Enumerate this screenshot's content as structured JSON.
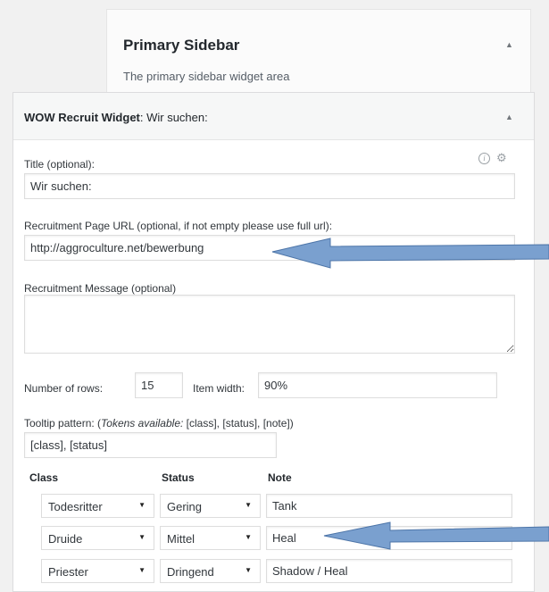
{
  "sidebar": {
    "title": "Primary Sidebar",
    "description": "The primary sidebar widget area",
    "toggle_glyph": "▲"
  },
  "widget": {
    "name": "WOW Recruit Widget",
    "title_suffix": ": Wir suchen:",
    "toggle_glyph": "▲",
    "icons": [
      "info-icon",
      "bug-icon"
    ],
    "title_label": "Title (optional):",
    "title_value": "Wir suchen:",
    "url_label": "Recruitment Page URL (optional, if not empty please use full url):",
    "url_value": "http://aggroculture.net/bewerbung",
    "message_label": "Recruitment Message (optional)",
    "message_value": "",
    "rows_label": "Number of rows:",
    "rows_value": "15",
    "width_label": "Item width:",
    "width_value": "90%",
    "tooltip_label_prefix": "Tooltip pattern: (",
    "tooltip_label_tokens": "Tokens available:",
    "tooltip_label_suffix": " [class], [status], [note])",
    "tooltip_value": "[class], [status]",
    "table": {
      "headers": [
        "Class",
        "Status",
        "Note"
      ],
      "rows": [
        {
          "class": "Todesritter",
          "status": "Gering",
          "note": "Tank"
        },
        {
          "class": "Druide",
          "status": "Mittel",
          "note": "Heal"
        },
        {
          "class": "Priester",
          "status": "Dringend",
          "note": "Shadow / Heal"
        }
      ]
    }
  },
  "annotations": {
    "arrow_color": "#7aa0cf",
    "arrow_stroke": "#4d75a8"
  }
}
